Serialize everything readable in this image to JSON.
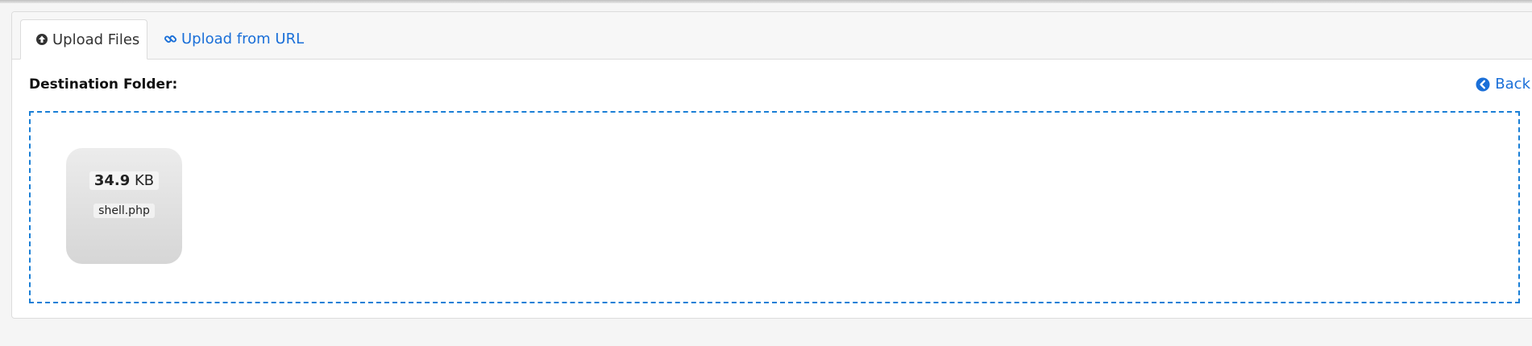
{
  "tabs": [
    {
      "label": "Upload Files",
      "icon": "upload-circle-icon",
      "active": true
    },
    {
      "label": "Upload from URL",
      "icon": "link-icon",
      "active": false
    }
  ],
  "destination": {
    "label": "Destination Folder:"
  },
  "back": {
    "label": "Back",
    "icon": "back-circle-icon"
  },
  "file": {
    "size_value": "34.9",
    "size_unit": "KB",
    "name": "shell.php"
  },
  "colors": {
    "accent": "#1a6fd8",
    "dropzone_border": "#1a7fd6"
  }
}
